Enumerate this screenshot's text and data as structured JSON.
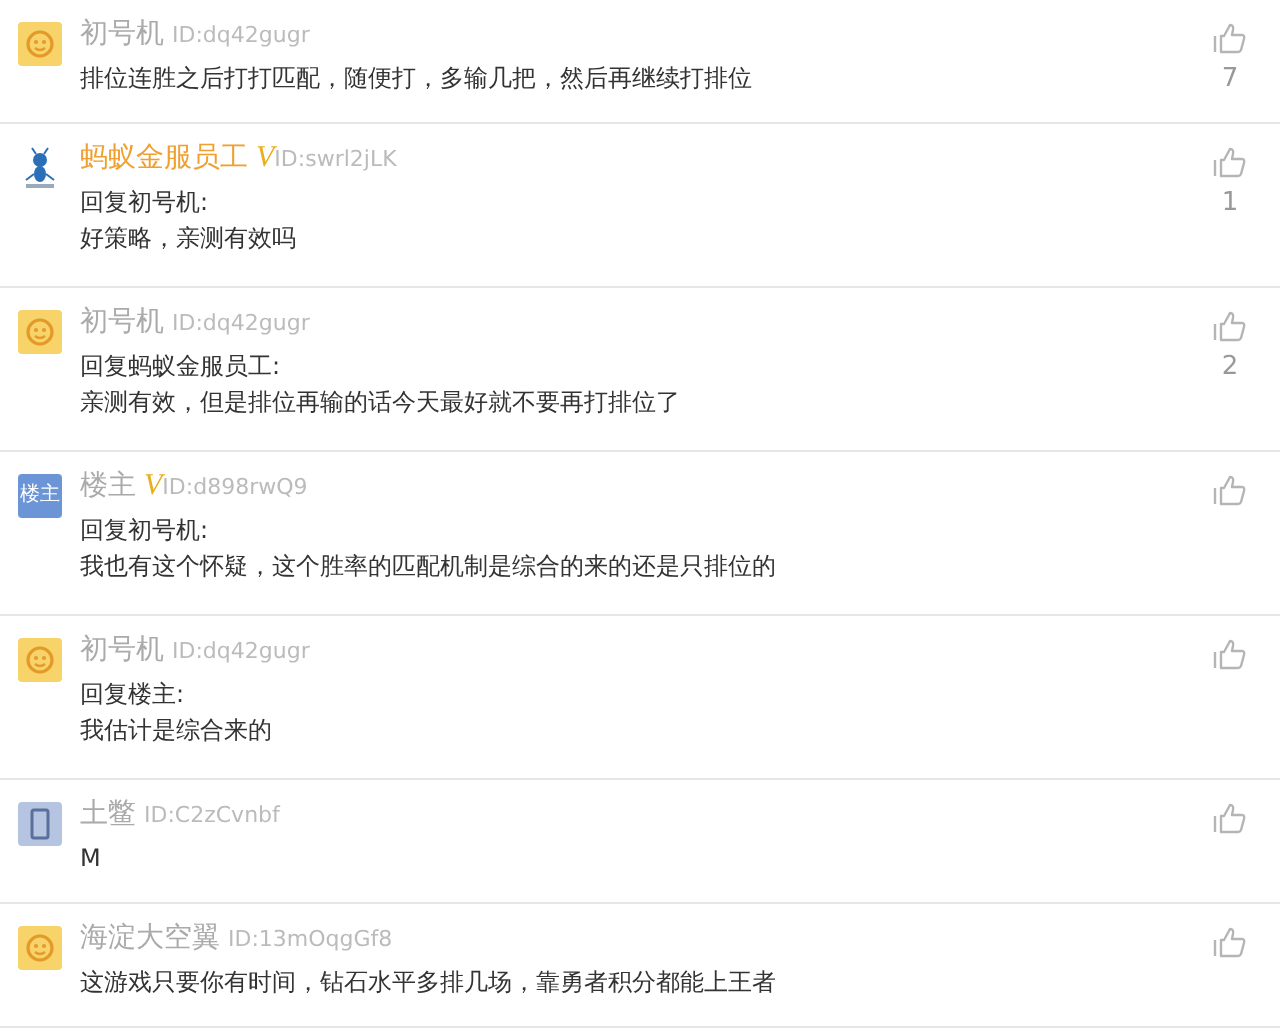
{
  "comments": [
    {
      "avatar": {
        "kind": "smiley"
      },
      "name": "初号机",
      "highlighted": false,
      "id": "ID:dq42gugr",
      "body": "排位连胜之后打打匹配，随便打，多输几把，然后再继续打排位",
      "likes": "7"
    },
    {
      "avatar": {
        "kind": "ant"
      },
      "name": "蚂蚁金服员工",
      "highlighted": true,
      "vip": "V",
      "id": "ID:swrl2jLK",
      "reply_to": "回复初号机:",
      "body": "好策略，亲测有效吗",
      "likes": "1"
    },
    {
      "avatar": {
        "kind": "smiley"
      },
      "name": "初号机",
      "highlighted": false,
      "id": "ID:dq42gugr",
      "reply_to": "回复蚂蚁金服员工:",
      "body": "亲测有效，但是排位再输的话今天最好就不要再打排位了",
      "likes": "2"
    },
    {
      "avatar": {
        "kind": "label",
        "text": "楼主"
      },
      "name": "楼主",
      "highlighted": false,
      "vip": "V",
      "id": "ID:d898rwQ9",
      "reply_to": "回复初号机:",
      "body": "我也有这个怀疑，这个胜率的匹配机制是综合的来的还是只排位的"
    },
    {
      "avatar": {
        "kind": "smiley"
      },
      "name": "初号机",
      "highlighted": false,
      "id": "ID:dq42gugr",
      "reply_to": "回复楼主:",
      "body": "我估计是综合来的"
    },
    {
      "avatar": {
        "kind": "phone"
      },
      "name": "土鳖",
      "highlighted": false,
      "id": "ID:C2zCvnbf",
      "body": "M"
    },
    {
      "avatar": {
        "kind": "smiley"
      },
      "name": "海淀大空翼",
      "highlighted": false,
      "id": "ID:13mOqgGf8",
      "body": "这游戏只要你有时间，钻石水平多排几场，靠勇者积分都能上王者"
    }
  ]
}
